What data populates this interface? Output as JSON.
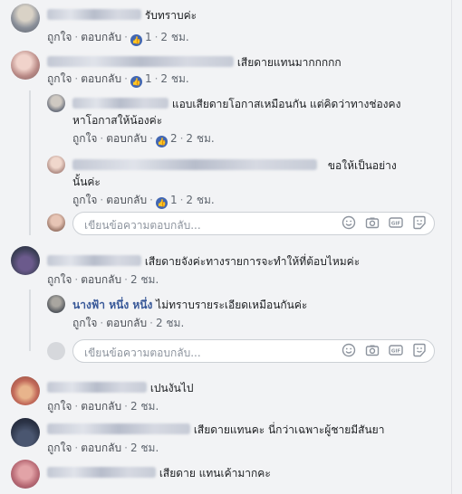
{
  "actions": {
    "like": "ถูกใจ",
    "reply": "ตอบกลับ"
  },
  "reply_placeholder": "เขียนข้อความตอบกลับ...",
  "comments": [
    {
      "text": "รับทราบค่ะ",
      "likes": "1",
      "time": "2 ชม."
    },
    {
      "text": "เสียดายแทนมากกกกก",
      "likes": "1",
      "time": "2 ชม."
    },
    {
      "text_line1": "แอบเสียดายโอกาสเหมือนกัน แต่คิดว่าทางช่องคง",
      "text_line2": "หาโอกาสให้น้องค่ะ",
      "likes": "2",
      "time": "2 ชม."
    },
    {
      "text_line1": "ขอให้เป็นอย่าง",
      "text_line2": "นั้นค่ะ",
      "likes": "1",
      "time": "2 ชม."
    },
    {
      "text": "เสียดายจังค่ะทางรายการจะทำให้ที่ต้อบไหมค่ะ",
      "time": "2 ชม."
    },
    {
      "author": "นางฟ้า หนึ่ง หนึ่ง",
      "text": "ไม่ทราบรายระเอียดเหมือนกันค่ะ",
      "time": "2 ชม."
    },
    {
      "text": "เปนงันไป",
      "time": "2 ชม."
    },
    {
      "text": "เสียดายแทนคะ นี่กว่าเฉพาะผู้ชายมีสันยา",
      "time": "2 ชม."
    },
    {
      "text": "เสียดาย แทนเค้ามากคะ"
    }
  ],
  "colors": {
    "accent": "#4267b2",
    "name": "#385898",
    "action": "#4b4f56",
    "meta": "#606770"
  },
  "icons": [
    "emoji-icon",
    "camera-icon",
    "gif-icon",
    "sticker-icon",
    "like-icon"
  ]
}
